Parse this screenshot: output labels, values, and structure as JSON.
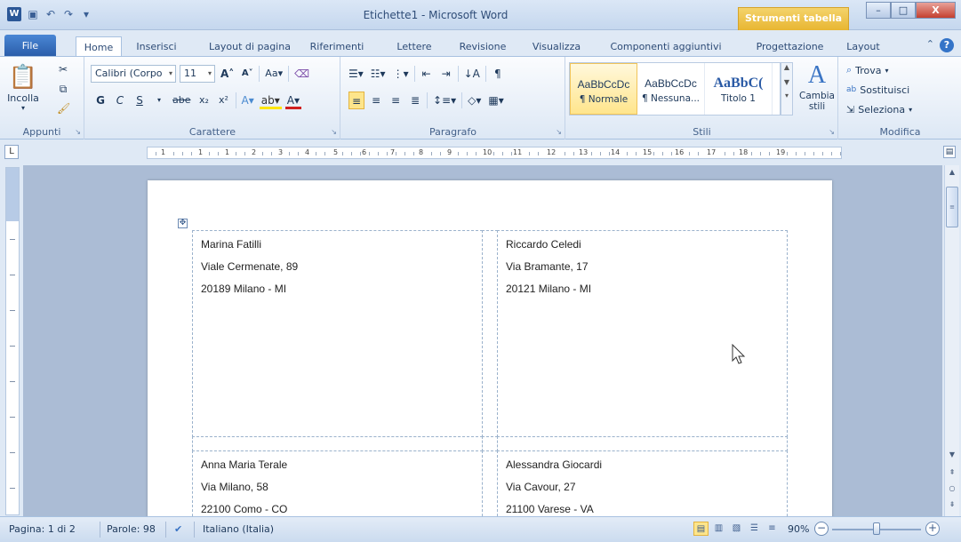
{
  "window": {
    "title": "Etichette1 - Microsoft Word",
    "context_tab": "Strumenti tabella",
    "controls": [
      "–",
      "□",
      "X"
    ]
  },
  "tabs": [
    "File",
    "Home",
    "Inserisci",
    "Layout di pagina",
    "Riferimenti",
    "Lettere",
    "Revisione",
    "Visualizza",
    "Componenti aggiuntivi",
    "Progettazione",
    "Layout"
  ],
  "active_tab": "Home",
  "ribbon": {
    "clipboard": {
      "paste": "Incolla",
      "label": "Appunti"
    },
    "font": {
      "name": "Calibri (Corpo",
      "size": "11",
      "label": "Carattere",
      "bold": "G",
      "italic": "C",
      "underline": "S",
      "strike": "abe"
    },
    "paragraph": {
      "label": "Paragrafo"
    },
    "styles": {
      "label": "Stili",
      "items": [
        {
          "sample": "AaBbCcDc",
          "name": "¶ Normale"
        },
        {
          "sample": "AaBbCcDc",
          "name": "¶ Nessuna..."
        },
        {
          "sample": "AaBbC(",
          "name": "Titolo 1"
        }
      ],
      "change": "Cambia stili"
    },
    "editing": {
      "label": "Modifica",
      "find": "Trova",
      "replace": "Sostituisci",
      "select": "Seleziona"
    }
  },
  "ruler": {
    "numbers": [
      "1",
      "1",
      "1",
      "2",
      "3",
      "4",
      "5",
      "6",
      "7",
      "8",
      "9",
      "10",
      "11",
      "12",
      "13",
      "14",
      "15",
      "16",
      "17",
      "18",
      "19"
    ]
  },
  "labels": [
    {
      "lines": [
        "Marina Fatilli",
        "Viale Cermenate, 89",
        "20189 Milano - MI"
      ]
    },
    {
      "lines": [
        "Riccardo Celedi",
        "Via Bramante, 17",
        "20121 Milano - MI"
      ]
    },
    {
      "lines": [
        "Anna Maria Terale",
        "Via Milano, 58",
        "22100 Como - CO"
      ]
    },
    {
      "lines": [
        "Alessandra Giocardi",
        "Via Cavour, 27",
        "21100 Varese - VA"
      ]
    }
  ],
  "status": {
    "page": "Pagina: 1 di 2",
    "words": "Parole: 98",
    "language": "Italiano (Italia)",
    "zoom": "90%",
    "zoom_percent": 90
  },
  "colors": {
    "ribbon_bg": "#dde8f5",
    "context_tab": "#e8b632",
    "file_tab": "#2a5ca8"
  }
}
